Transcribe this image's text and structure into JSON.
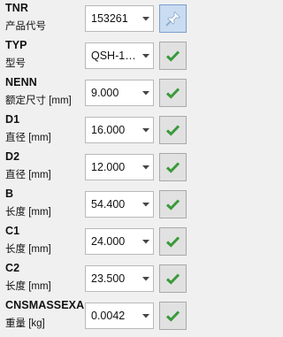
{
  "colors": {
    "check": "#3a9a3a",
    "pin_fill": "#ffffff",
    "pin_button_bg": "#c9dcf1",
    "button_bg": "#e1e1e1"
  },
  "rows": [
    {
      "code": "TNR",
      "desc": "产品代号",
      "value": "153261",
      "button_icon": "pin-icon"
    },
    {
      "code": "TYP",
      "desc": "型号",
      "value": "QSH-1…",
      "button_icon": "check-icon"
    },
    {
      "code": "NENN",
      "desc": "额定尺寸 [mm]",
      "value": "9.000",
      "button_icon": "check-icon"
    },
    {
      "code": "D1",
      "desc": "直径 [mm]",
      "value": "16.000",
      "button_icon": "check-icon"
    },
    {
      "code": "D2",
      "desc": "直径 [mm]",
      "value": "12.000",
      "button_icon": "check-icon"
    },
    {
      "code": "B",
      "desc": "长度 [mm]",
      "value": "54.400",
      "button_icon": "check-icon"
    },
    {
      "code": "C1",
      "desc": "长度 [mm]",
      "value": "24.000",
      "button_icon": "check-icon"
    },
    {
      "code": "C2",
      "desc": "长度 [mm]",
      "value": "23.500",
      "button_icon": "check-icon"
    },
    {
      "code": "CNSMASSEXA",
      "desc": "重量 [kg]",
      "value": "0.0042",
      "button_icon": "check-icon"
    }
  ]
}
